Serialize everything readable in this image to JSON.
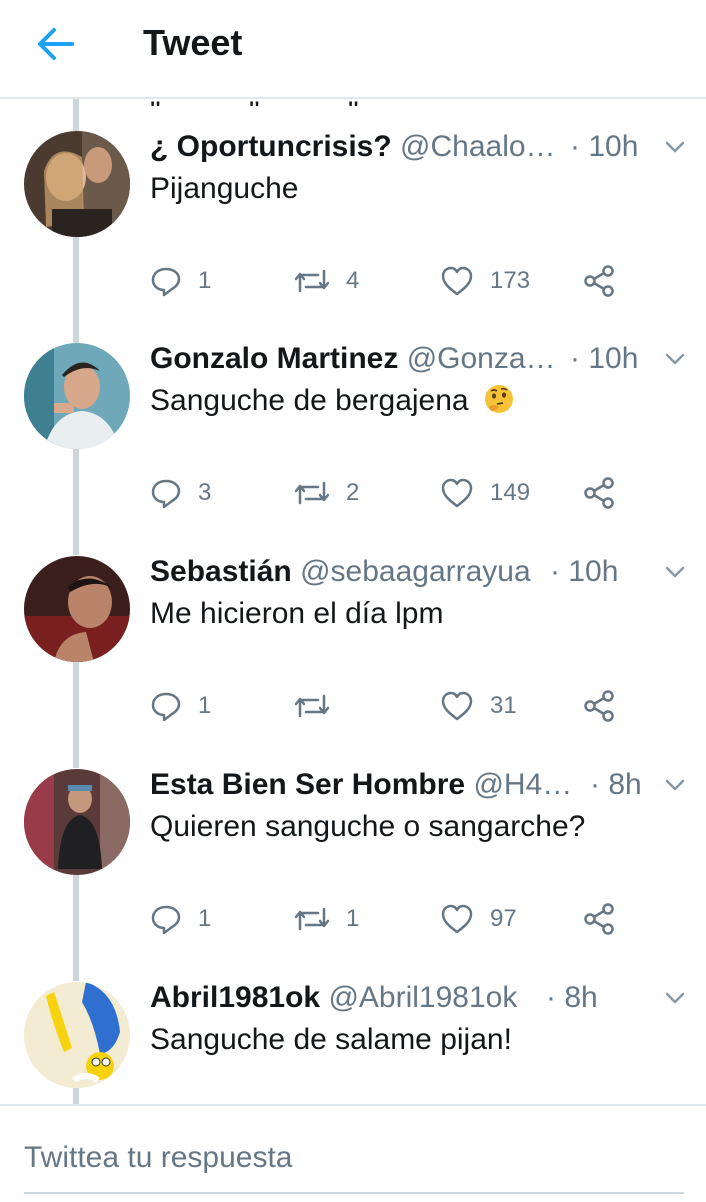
{
  "header": {
    "title": "Tweet"
  },
  "clipped_text": "\" \" \" \" \" \" \" \"",
  "tweets": [
    {
      "name": "¿ Oportuncrisis?",
      "handle": "@Chaalo…",
      "time": "· 10h",
      "text": "Pijanguche",
      "emoji": "",
      "replies": "1",
      "retweets": "4",
      "likes": "173"
    },
    {
      "name": "Gonzalo Martinez",
      "handle": "@Gonza…",
      "time": "· 10h",
      "text": "Sanguche de bergajena",
      "emoji": "thinking-face",
      "replies": "3",
      "retweets": "2",
      "likes": "149"
    },
    {
      "name": "Sebastián",
      "handle": "@sebaagarrayua",
      "time": "· 10h",
      "text": "Me hicieron el día lpm",
      "emoji": "",
      "replies": "1",
      "retweets": "",
      "likes": "31"
    },
    {
      "name": "Esta Bien Ser Hombre",
      "handle": "@H4…",
      "time": "· 8h",
      "text": "Quieren sanguche o sangarche?",
      "emoji": "",
      "replies": "1",
      "retweets": "1",
      "likes": "97"
    },
    {
      "name": "Abril1981ok",
      "handle": "@Abril1981ok",
      "time": "· 8h",
      "text": "Sanguche de salame pijan!",
      "emoji": "",
      "replies": "",
      "retweets": "",
      "likes": ""
    }
  ],
  "reply": {
    "placeholder": "Twittea tu respuesta"
  },
  "colors": {
    "accent": "#1da1f2",
    "text": "#14171a",
    "muted": "#657786",
    "line": "#ccd6dd"
  },
  "icons": [
    "back-arrow-icon",
    "chevron-down-icon",
    "reply-icon",
    "retweet-icon",
    "like-icon",
    "share-icon"
  ]
}
